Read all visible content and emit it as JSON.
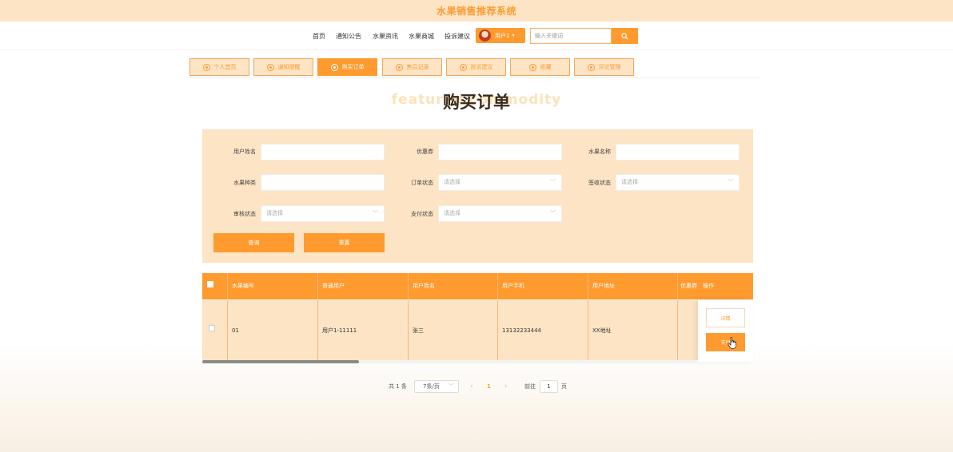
{
  "site": {
    "title": "水果销售推荐系统"
  },
  "nav": {
    "links": [
      "首页",
      "通知公告",
      "水果资讯",
      "水果商城",
      "投诉建议"
    ],
    "user_label": "用户1",
    "search_placeholder": "输入关键词"
  },
  "tabs": [
    {
      "label": "个人首页",
      "active": false
    },
    {
      "label": "通知提醒",
      "active": false
    },
    {
      "label": "购买订单",
      "active": true
    },
    {
      "label": "售后记录",
      "active": false
    },
    {
      "label": "投诉建议",
      "active": false
    },
    {
      "label": "收藏",
      "active": false
    },
    {
      "label": "评论管理",
      "active": false
    }
  ],
  "page": {
    "title": "购买订单",
    "bg_title": "featured commodity"
  },
  "filters": {
    "user_name": {
      "label": "用户姓名"
    },
    "coupon": {
      "label": "优惠券"
    },
    "fruit_name": {
      "label": "水果名称"
    },
    "fruit_type": {
      "label": "水果种类"
    },
    "order_status": {
      "label": "订单状态",
      "placeholder": "请选择"
    },
    "sign_status": {
      "label": "签收状态",
      "placeholder": "请选择"
    },
    "audit_status": {
      "label": "审核状态",
      "placeholder": "请选择"
    },
    "pay_status": {
      "label": "支付状态",
      "placeholder": "请选择"
    },
    "query_label": "查询",
    "reset_label": "重置"
  },
  "table": {
    "headers": [
      "水果编号",
      "普通用户",
      "用户姓名",
      "用户手机",
      "用户地址",
      "优惠券",
      "操作"
    ],
    "rows": [
      {
        "fruit_no": "01",
        "user": "用户1-11111",
        "name": "张三",
        "phone": "13132233444",
        "address": "XX地址"
      }
    ],
    "detail_label": "详情",
    "pay_label": "支付"
  },
  "pagination": {
    "total_label": "共 1 条",
    "page_size": "7条/页",
    "prev": "‹",
    "current": "1",
    "next": "›",
    "goto_prefix": "前往",
    "goto_value": "1",
    "goto_suffix": "页"
  },
  "colors": {
    "accent": "#ff9a2e",
    "panel": "#fde4c4"
  }
}
